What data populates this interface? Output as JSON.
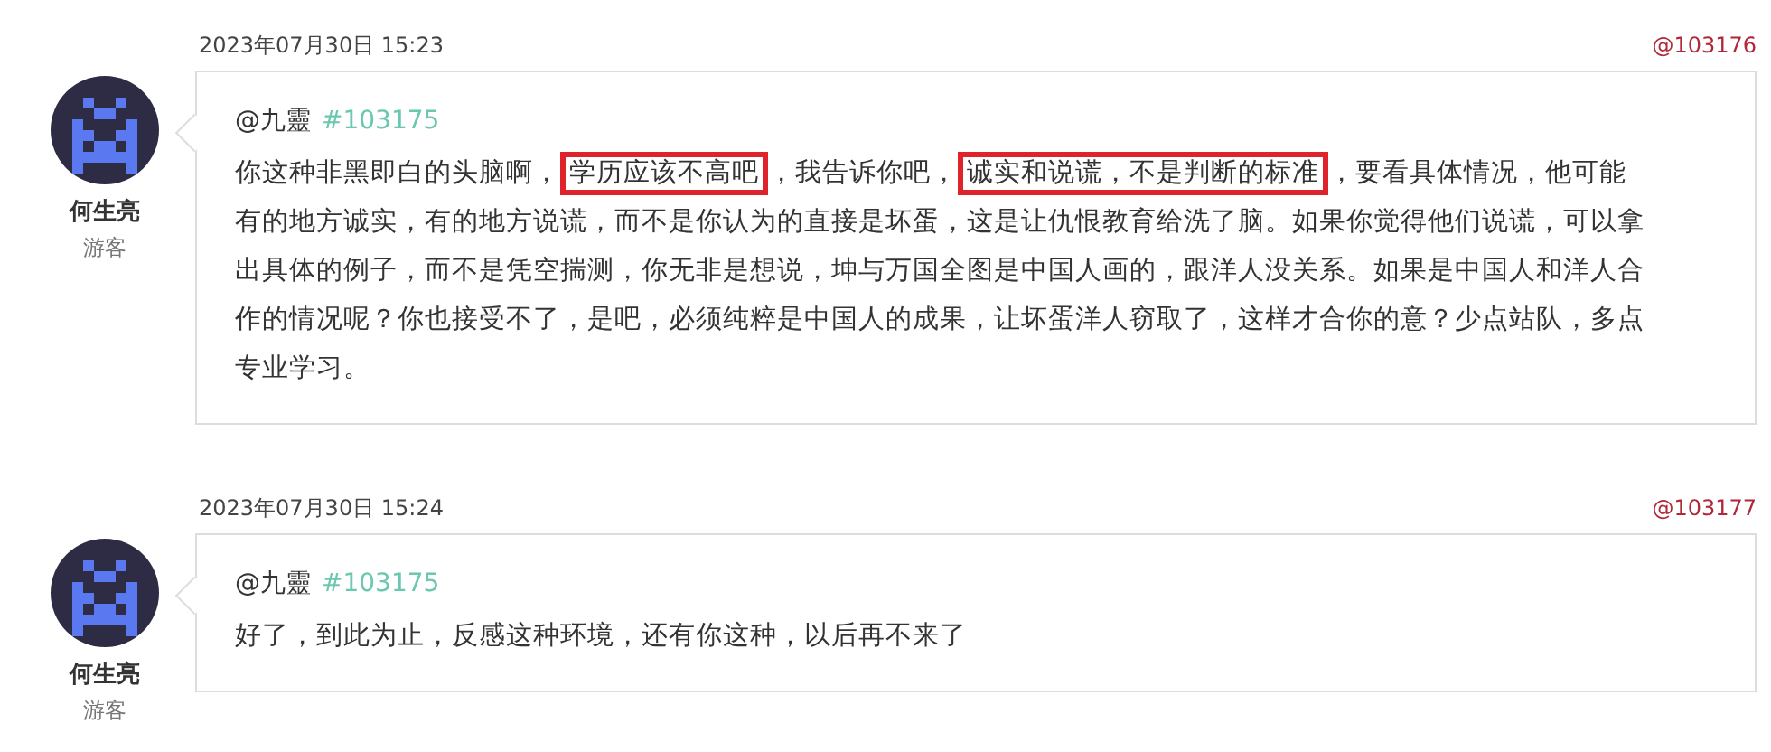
{
  "comments": [
    {
      "author": "何生亮",
      "role": "游客",
      "date": "2023年07月30日 15:23",
      "floor": "@103176",
      "reply_to": {
        "user": "@九靈",
        "ref": "#103175"
      },
      "body": [
        {
          "text": "你这种非黑即白的头脑啊，",
          "boxed": false
        },
        {
          "text": "学历应该不高吧",
          "boxed": true
        },
        {
          "text": "，我告诉你吧，",
          "boxed": false
        },
        {
          "text": "诚实和说谎，不是判断的标准",
          "boxed": true
        },
        {
          "text": "，要看具体情况，他可能有的地方诚实，有的地方说谎，而不是你认为的直接是坏蛋，这是让仇恨教育给洗了脑。如果你觉得他们说谎，可以拿出具体的例子，而不是凭空揣测，你无非是想说，坤与万国全图是中国人画的，跟洋人没关系。如果是中国人和洋人合作的情况呢？你也接受不了，是吧，必须纯粹是中国人的成果，让坏蛋洋人窃取了，这样才合你的意？少点站队，多点专业学习。",
          "boxed": false
        }
      ]
    },
    {
      "author": "何生亮",
      "role": "游客",
      "date": "2023年07月30日 15:24",
      "floor": "@103177",
      "reply_to": {
        "user": "@九靈",
        "ref": "#103175"
      },
      "body": [
        {
          "text": "好了，到此为止，反感这种环境，还有你这种，以后再不来了",
          "boxed": false
        }
      ]
    }
  ]
}
